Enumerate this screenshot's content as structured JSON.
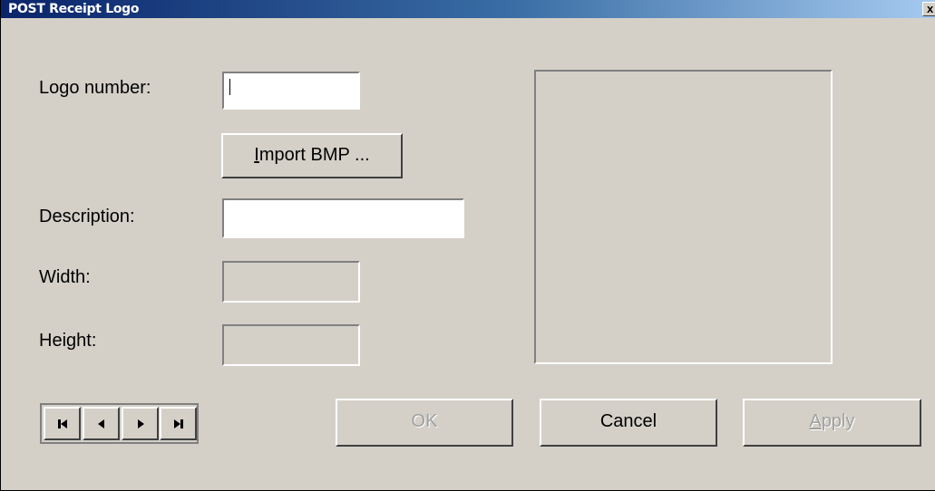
{
  "window": {
    "title": "POST Receipt Logo",
    "close_glyph": "x"
  },
  "form": {
    "logo_number": {
      "label": "Logo number:",
      "value": ""
    },
    "import_button": {
      "mnemonic": "I",
      "rest": "mport BMP ..."
    },
    "description": {
      "label": "Description:",
      "value": ""
    },
    "width": {
      "label": "Width:",
      "value": ""
    },
    "height": {
      "label": "Height:",
      "value": ""
    }
  },
  "navigation": {
    "icons": [
      "first-record-icon",
      "previous-record-icon",
      "next-record-icon",
      "last-record-icon"
    ]
  },
  "buttons": {
    "ok": {
      "label": "OK",
      "enabled": false
    },
    "cancel": {
      "label": "Cancel",
      "enabled": true
    },
    "apply": {
      "mnemonic": "A",
      "rest": "pply",
      "enabled": false
    }
  },
  "colors": {
    "window_bg": "#d4d0c8",
    "titlebar_start": "#0a246a",
    "titlebar_end": "#a6caf0",
    "disabled_text": "#a0a0a0"
  }
}
